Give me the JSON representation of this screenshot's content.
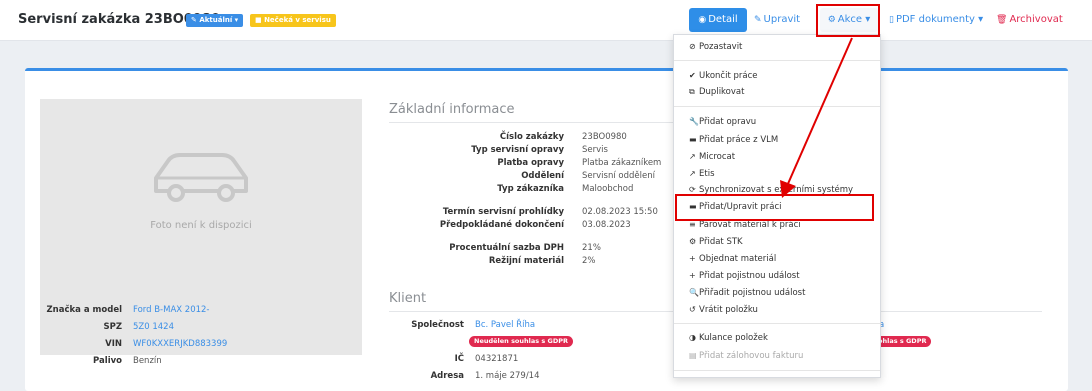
{
  "header": {
    "title": "Servisní zakázka 23BO0980",
    "status_badge": "Aktuální",
    "service_badge": "Nečeká v servisu"
  },
  "toolbar": {
    "detail": "Detail",
    "upravit": "Upravit",
    "akce": "Akce",
    "pdf": "PDF dokumenty",
    "archivovat": "Archivovat"
  },
  "photo": {
    "placeholder": "Foto není k dispozici"
  },
  "basic": {
    "heading": "Základní informace",
    "rows": [
      {
        "label": "Číslo zakázky",
        "value": "23BO0980"
      },
      {
        "label": "Typ servisní opravy",
        "value": "Servis"
      },
      {
        "label": "Platba opravy",
        "value": "Platba zákazníkem"
      },
      {
        "label": "Oddělení",
        "value": "Servisní oddělení"
      },
      {
        "label": "Typ zákazníka",
        "value": "Maloobchod"
      },
      {
        "label": "Termín servisní prohlídky",
        "value": "02.08.2023 15:50"
      },
      {
        "label": "Předpokládané dokončení",
        "value": "03.08.2023"
      },
      {
        "label": "Procentuální sazba DPH",
        "value": "21%"
      },
      {
        "label": "Režijní materiál",
        "value": "2%"
      }
    ]
  },
  "vehicle": [
    {
      "label": "Značka a model",
      "value": "Ford B-MAX 2012-"
    },
    {
      "label": "SPZ",
      "value": "5Z0 1424"
    },
    {
      "label": "VIN",
      "value": "WF0KXXERJKD883399"
    },
    {
      "label": "Palivo",
      "value": "Benzín"
    }
  ],
  "client": {
    "heading": "Klient",
    "company_label": "Společnost",
    "company_value": "Bc. Pavel Říha",
    "consent_badge": "Neudělen souhlas s GDPR",
    "ic_label": "IČ",
    "ic_value": "04321871",
    "address_label": "Adresa",
    "address_value": "1. máje 279/14",
    "right_value": "a",
    "right_badge": "ohlas s GDPR"
  },
  "menu": {
    "items": [
      {
        "label": "Pozastavit",
        "icon": "⊘"
      },
      {
        "label": "Ukončit práce",
        "icon": "✔"
      },
      {
        "label": "Duplikovat",
        "icon": "⧉"
      },
      {
        "label": "Přidat opravu",
        "icon": "🔧"
      },
      {
        "label": "Přidat práce z VLM",
        "icon": "▬"
      },
      {
        "label": "Microcat",
        "icon": "↗"
      },
      {
        "label": "Etis",
        "icon": "↗"
      },
      {
        "label": "Synchronizovat s externími systémy",
        "icon": "⟳"
      },
      {
        "label": "Přidat/Upravit práci",
        "icon": "▬"
      },
      {
        "label": "Párovat materiál k práci",
        "icon": "≡"
      },
      {
        "label": "Přidat STK",
        "icon": "⚙"
      },
      {
        "label": "Objednat materiál",
        "icon": "+"
      },
      {
        "label": "Přidat pojistnou událost",
        "icon": "+"
      },
      {
        "label": "Přiřadit pojistnou událost",
        "icon": "🔍"
      },
      {
        "label": "Vrátit položku",
        "icon": "↺"
      },
      {
        "label": "Kulance položek",
        "icon": "◑"
      },
      {
        "label": "Přidat zálohovou fakturu",
        "icon": "▤"
      }
    ]
  },
  "colors": {
    "accent": "#3a8ee6",
    "danger": "#e0294f",
    "warning": "#f7c51b",
    "highlight": "#e00000"
  }
}
